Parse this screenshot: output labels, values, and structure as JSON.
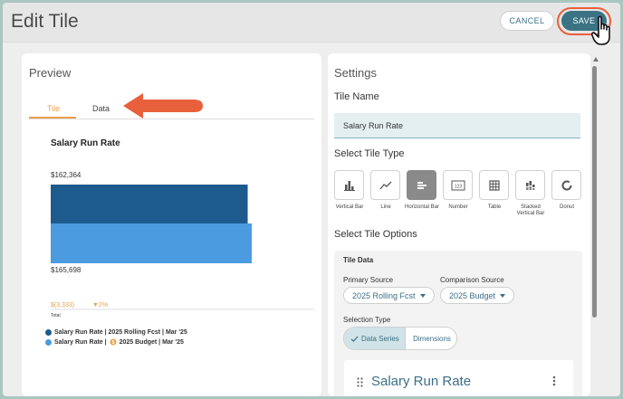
{
  "header": {
    "title": "Edit Tile",
    "cancel_label": "CANCEL",
    "save_label": "SAVE"
  },
  "preview": {
    "title": "Preview",
    "tabs": [
      {
        "label": "Tile",
        "active": true
      },
      {
        "label": "Data",
        "active": false
      }
    ],
    "chart_data": {
      "type": "bar",
      "orientation": "horizontal",
      "title": "Salary Run Rate",
      "categories": [
        "Total"
      ],
      "series": [
        {
          "name": "Salary Run Rate | 2025 Rolling Fcst | Mar '25",
          "values": [
            162364
          ],
          "label": "$162,364",
          "color": "#1d5a8e"
        },
        {
          "name": "Salary Run Rate | 2025 Budget | Mar '25",
          "values": [
            165698
          ],
          "label": "$165,698",
          "color": "#4a9be0"
        }
      ],
      "variance_value": "$(3,333)",
      "variance_pct": "▼2%",
      "variance_color": "#e8a04c",
      "legend": [
        {
          "text": "Salary Run Rate | 2025 Rolling Fcst | Mar '25",
          "color": "#1d5a8e"
        },
        {
          "text": "Salary Run Rate | ",
          "badge_icon": "budget-icon",
          "suffix": "2025 Budget | Mar '25",
          "color": "#4a9be0"
        }
      ]
    }
  },
  "settings": {
    "title": "Settings",
    "tile_name_label": "Tile Name",
    "tile_name_value": "Salary Run Rate",
    "tile_type_label": "Select Tile Type",
    "tile_types": [
      {
        "label": "Vertical Bar",
        "icon": "vertical-bar-icon",
        "selected": false
      },
      {
        "label": "Line",
        "icon": "line-icon",
        "selected": false
      },
      {
        "label": "Horizontal Bar",
        "icon": "horizontal-bar-icon",
        "selected": true
      },
      {
        "label": "Number",
        "icon": "number-icon",
        "selected": false
      },
      {
        "label": "Table",
        "icon": "table-icon",
        "selected": false
      },
      {
        "label": "Stacked Vertical Bar",
        "icon": "stacked-bar-icon",
        "selected": false
      },
      {
        "label": "Donut",
        "icon": "donut-icon",
        "selected": false
      }
    ],
    "tile_options_label": "Select Tile Options",
    "tile_data_label": "Tile Data",
    "primary_source_label": "Primary Source",
    "primary_source_value": "2025 Rolling Fcst",
    "comparison_source_label": "Comparison Source",
    "comparison_source_value": "2025 Budget",
    "selection_type_label": "Selection Type",
    "selection_options": [
      {
        "label": "Data Series",
        "selected": true
      },
      {
        "label": "Dimensions",
        "selected": false
      }
    ],
    "metric_card_title": "Salary Run Rate",
    "accent_color": "#3b7384",
    "highlight_color": "#e8603c"
  }
}
